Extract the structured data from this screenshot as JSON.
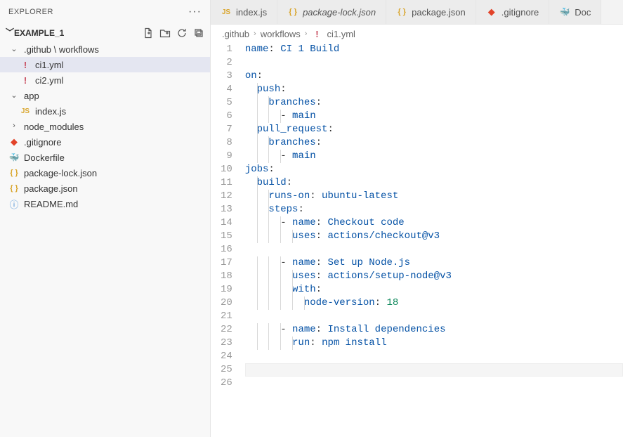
{
  "sidebar": {
    "title": "EXPLORER",
    "project": "EXAMPLE_1",
    "tree": [
      {
        "kind": "folder",
        "open": true,
        "label": ".github \\ workflows",
        "depth": 0,
        "icon": "chev"
      },
      {
        "kind": "file",
        "label": "ci1.yml",
        "depth": 1,
        "icon": "yaml",
        "selected": true
      },
      {
        "kind": "file",
        "label": "ci2.yml",
        "depth": 1,
        "icon": "yaml"
      },
      {
        "kind": "folder",
        "open": true,
        "label": "app",
        "depth": 0,
        "icon": "chev"
      },
      {
        "kind": "file",
        "label": "index.js",
        "depth": 1,
        "icon": "js"
      },
      {
        "kind": "folder",
        "open": false,
        "label": "node_modules",
        "depth": 0,
        "icon": "chev"
      },
      {
        "kind": "file",
        "label": ".gitignore",
        "depth": 0,
        "icon": "git"
      },
      {
        "kind": "file",
        "label": "Dockerfile",
        "depth": 0,
        "icon": "docker"
      },
      {
        "kind": "file",
        "label": "package-lock.json",
        "depth": 0,
        "icon": "json"
      },
      {
        "kind": "file",
        "label": "package.json",
        "depth": 0,
        "icon": "json"
      },
      {
        "kind": "file",
        "label": "README.md",
        "depth": 0,
        "icon": "readme"
      }
    ]
  },
  "tabs": [
    {
      "icon": "js",
      "label": "index.js",
      "italic": false
    },
    {
      "icon": "json",
      "label": "package-lock.json",
      "italic": true
    },
    {
      "icon": "json",
      "label": "package.json",
      "italic": false
    },
    {
      "icon": "git",
      "label": ".gitignore",
      "italic": false
    },
    {
      "icon": "docker",
      "label": "Doc",
      "italic": false
    }
  ],
  "breadcrumb": [
    {
      "text": ".github",
      "icon": null
    },
    {
      "text": "workflows",
      "icon": null
    },
    {
      "text": "ci1.yml",
      "icon": "yaml"
    }
  ],
  "code": {
    "cursor_line": 25,
    "lines": [
      {
        "n": 1,
        "indent": 0,
        "tokens": [
          [
            "name",
            "key"
          ],
          [
            ": ",
            null
          ],
          [
            "CI 1 Build",
            "str"
          ]
        ]
      },
      {
        "n": 2,
        "indent": 0,
        "tokens": []
      },
      {
        "n": 3,
        "indent": 0,
        "tokens": [
          [
            "on",
            "key"
          ],
          [
            ":",
            null
          ]
        ]
      },
      {
        "n": 4,
        "indent": 1,
        "tokens": [
          [
            "push",
            "key"
          ],
          [
            ":",
            null
          ]
        ]
      },
      {
        "n": 5,
        "indent": 2,
        "tokens": [
          [
            "branches",
            "key"
          ],
          [
            ":",
            null
          ]
        ]
      },
      {
        "n": 6,
        "indent": 3,
        "tokens": [
          [
            "- ",
            null
          ],
          [
            "main",
            "str"
          ]
        ]
      },
      {
        "n": 7,
        "indent": 1,
        "tokens": [
          [
            "pull_request",
            "key"
          ],
          [
            ":",
            null
          ]
        ]
      },
      {
        "n": 8,
        "indent": 2,
        "tokens": [
          [
            "branches",
            "key"
          ],
          [
            ":",
            null
          ]
        ]
      },
      {
        "n": 9,
        "indent": 3,
        "tokens": [
          [
            "- ",
            null
          ],
          [
            "main",
            "str"
          ]
        ]
      },
      {
        "n": 10,
        "indent": 0,
        "tokens": [
          [
            "jobs",
            "key"
          ],
          [
            ":",
            null
          ]
        ]
      },
      {
        "n": 11,
        "indent": 1,
        "tokens": [
          [
            "build",
            "key"
          ],
          [
            ":",
            null
          ]
        ]
      },
      {
        "n": 12,
        "indent": 2,
        "tokens": [
          [
            "runs-on",
            "key"
          ],
          [
            ": ",
            null
          ],
          [
            "ubuntu-latest",
            "str"
          ]
        ]
      },
      {
        "n": 13,
        "indent": 2,
        "tokens": [
          [
            "steps",
            "key"
          ],
          [
            ":",
            null
          ]
        ]
      },
      {
        "n": 14,
        "indent": 3,
        "tokens": [
          [
            "- ",
            null
          ],
          [
            "name",
            "key"
          ],
          [
            ": ",
            null
          ],
          [
            "Checkout code",
            "str"
          ]
        ]
      },
      {
        "n": 15,
        "indent": 4,
        "tokens": [
          [
            "uses",
            "key"
          ],
          [
            ": ",
            null
          ],
          [
            "actions/checkout@v3",
            "str"
          ]
        ]
      },
      {
        "n": 16,
        "indent": 0,
        "tokens": []
      },
      {
        "n": 17,
        "indent": 3,
        "tokens": [
          [
            "- ",
            null
          ],
          [
            "name",
            "key"
          ],
          [
            ": ",
            null
          ],
          [
            "Set up Node.js",
            "str"
          ]
        ]
      },
      {
        "n": 18,
        "indent": 4,
        "tokens": [
          [
            "uses",
            "key"
          ],
          [
            ": ",
            null
          ],
          [
            "actions/setup-node@v3",
            "str"
          ]
        ]
      },
      {
        "n": 19,
        "indent": 4,
        "tokens": [
          [
            "with",
            "key"
          ],
          [
            ":",
            null
          ]
        ]
      },
      {
        "n": 20,
        "indent": 5,
        "tokens": [
          [
            "node-version",
            "key"
          ],
          [
            ": ",
            null
          ],
          [
            "18",
            "num"
          ]
        ]
      },
      {
        "n": 21,
        "indent": 0,
        "tokens": []
      },
      {
        "n": 22,
        "indent": 3,
        "tokens": [
          [
            "- ",
            null
          ],
          [
            "name",
            "key"
          ],
          [
            ": ",
            null
          ],
          [
            "Install dependencies",
            "str"
          ]
        ]
      },
      {
        "n": 23,
        "indent": 4,
        "tokens": [
          [
            "run",
            "key"
          ],
          [
            ": ",
            null
          ],
          [
            "npm install",
            "str"
          ]
        ]
      },
      {
        "n": 24,
        "indent": 0,
        "tokens": []
      },
      {
        "n": 25,
        "indent": 0,
        "tokens": []
      },
      {
        "n": 26,
        "indent": 0,
        "tokens": []
      }
    ]
  }
}
